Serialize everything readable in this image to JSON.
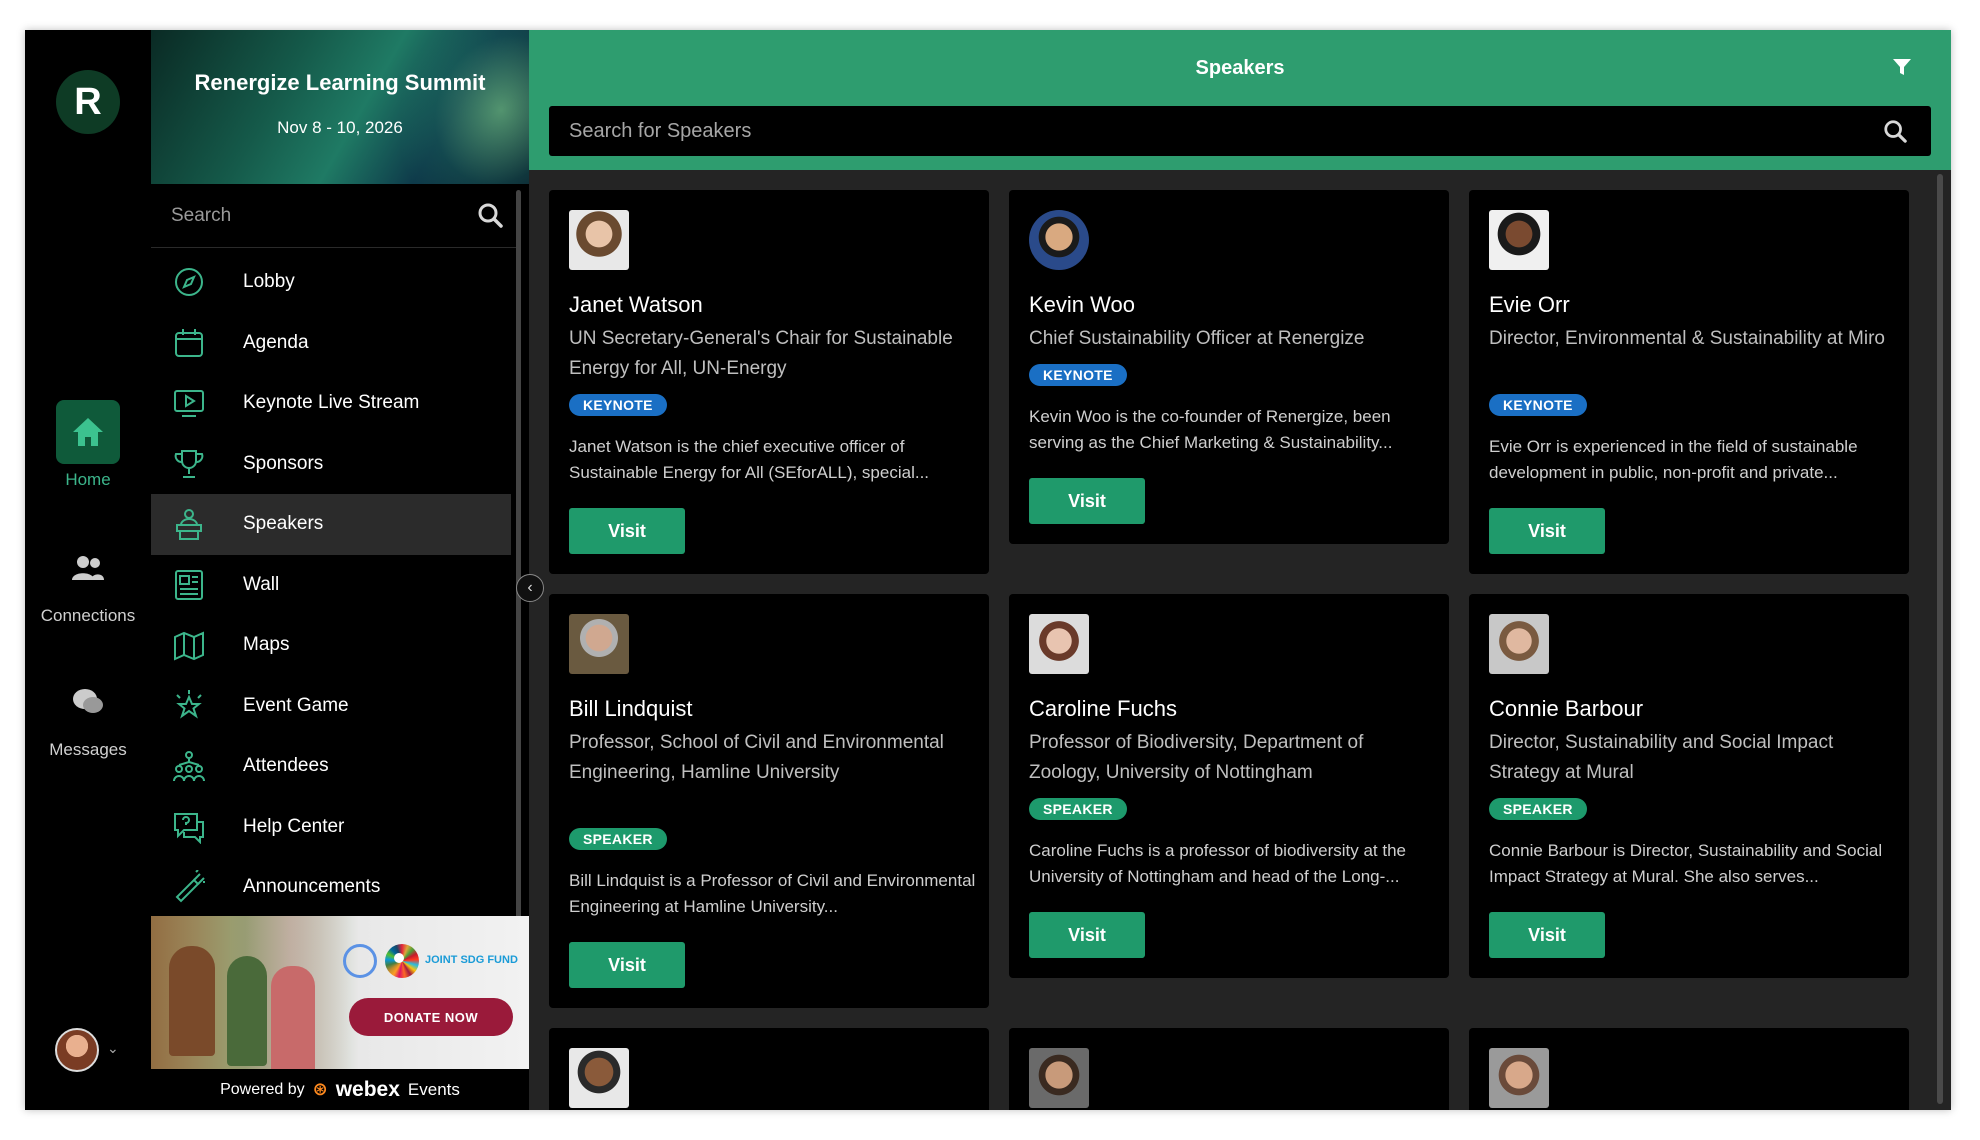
{
  "rail": {
    "items": [
      {
        "label": "Home"
      },
      {
        "label": "Connections"
      },
      {
        "label": "Messages"
      }
    ]
  },
  "event": {
    "title": "Renergize Learning Summit",
    "dates": "Nov 8 - 10, 2026"
  },
  "sidebar": {
    "search_placeholder": "Search",
    "items": [
      {
        "label": "Lobby",
        "icon": "compass-icon"
      },
      {
        "label": "Agenda",
        "icon": "calendar-icon"
      },
      {
        "label": "Keynote Live Stream",
        "icon": "livestream-icon"
      },
      {
        "label": "Sponsors",
        "icon": "trophy-icon"
      },
      {
        "label": "Speakers",
        "icon": "podium-icon",
        "active": true
      },
      {
        "label": "Wall",
        "icon": "newspaper-icon"
      },
      {
        "label": "Maps",
        "icon": "map-icon"
      },
      {
        "label": "Event Game",
        "icon": "star-icon"
      },
      {
        "label": "Attendees",
        "icon": "people-network-icon"
      },
      {
        "label": "Help Center",
        "icon": "help-chat-icon"
      },
      {
        "label": "Announcements",
        "icon": "megaphone-icon"
      }
    ]
  },
  "ad": {
    "fund_label": "JOINT SDG FUND",
    "donate_label": "DONATE NOW"
  },
  "footer": {
    "powered_prefix": "Powered by",
    "brand_name": "webex",
    "brand_suffix": "Events"
  },
  "main": {
    "title": "Speakers",
    "search_placeholder": "Search for Speakers",
    "visit_label": "Visit",
    "speakers": [
      {
        "name": "Janet Watson",
        "role": "UN Secretary-General's Chair for Sustainable Energy for All, UN-Energy",
        "badge": "KEYNOTE",
        "bio": "Janet Watson is the chief executive officer of Sustainable Energy for All (SEforALL), special..."
      },
      {
        "name": "Kevin Woo",
        "role": "Chief Sustainability Officer at Renergize",
        "badge": "KEYNOTE",
        "bio": "Kevin Woo is the co-founder of Renergize, been serving as the Chief Marketing & Sustainability..."
      },
      {
        "name": "Evie Orr",
        "role": "Director, Environmental & Sustainability at Miro",
        "badge": "KEYNOTE",
        "bio": "Evie Orr is experienced in the field of sustainable development in public, non-profit and private..."
      },
      {
        "name": "Bill Lindquist",
        "role": "Professor, School of Civil and Environmental Engineering, Hamline University",
        "badge": "SPEAKER",
        "bio": "Bill Lindquist is a Professor of Civil and Environmental Engineering at Hamline University..."
      },
      {
        "name": "Caroline Fuchs",
        "role": "Professor of Biodiversity, Department of Zoology, University of Nottingham",
        "badge": "SPEAKER",
        "bio": "Caroline Fuchs is a professor of biodiversity at the University of Nottingham and head of the Long-..."
      },
      {
        "name": "Connie Barbour",
        "role": "Director, Sustainability and Social Impact Strategy at Mural",
        "badge": "SPEAKER",
        "bio": "Connie Barbour is Director, Sustainability and Social Impact Strategy at Mural. She also serves..."
      }
    ]
  },
  "colors": {
    "accent": "#2e9d6f",
    "button": "#1f9a6b",
    "keynote_badge": "#1a6fc4",
    "speaker_badge": "#1d9a6c"
  }
}
